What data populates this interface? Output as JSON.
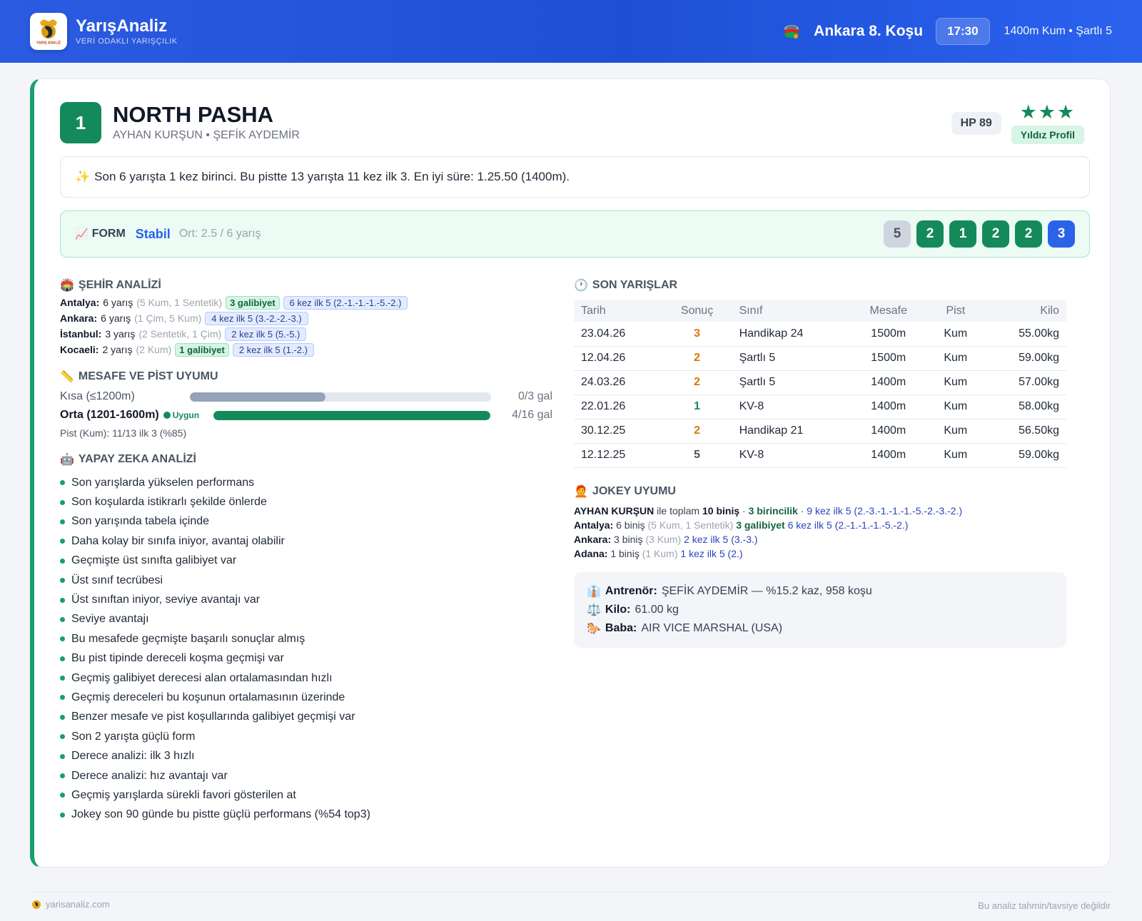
{
  "brand": {
    "name": "YarışAnaliz",
    "tagline": "VERİ ODAKLI YARIŞÇILIK",
    "logo_text": "YARIŞ ANALİZ"
  },
  "race": {
    "title": "Ankara 8. Koşu",
    "time": "17:30",
    "info": "1400m Kum • Şartlı 5",
    "icon": "saddle-icon"
  },
  "horse": {
    "number": "1",
    "name": "NORTH PASHA",
    "sub": "AYHAN KURŞUN • ŞEFİK AYDEMİR",
    "hp": "HP 89",
    "stars": "★★★",
    "profile": "Yıldız Profil"
  },
  "summary": {
    "icon": "✨",
    "text": "Son 6 yarışta 1 kez birinci. Bu pistte 13 yarışta 11 kez ilk 3. En iyi süre: 1.25.50 (1400m)."
  },
  "form": {
    "icon": "📈",
    "label": "FORM",
    "status": "Stabil",
    "avg": "Ort: 2.5 / 6 yarış",
    "results": [
      {
        "value": "5",
        "color": "gray"
      },
      {
        "value": "2",
        "color": "green"
      },
      {
        "value": "1",
        "color": "green"
      },
      {
        "value": "2",
        "color": "green"
      },
      {
        "value": "2",
        "color": "green"
      },
      {
        "value": "3",
        "color": "blue"
      }
    ]
  },
  "city_analysis": {
    "icon": "🏟️",
    "title": "ŞEHİR ANALİZİ",
    "rows": [
      {
        "city": "Antalya:",
        "races": "6 yarış",
        "detail": "(5 Kum, 1 Sentetik)",
        "wins": "3 galibiyet",
        "top5": "6 kez ilk 5 (2.-1.-1.-1.-5.-2.)"
      },
      {
        "city": "Ankara:",
        "races": "6 yarış",
        "detail": "(1 Çim, 5 Kum)",
        "wins": "",
        "top5": "4 kez ilk 5 (3.-2.-2.-3.)"
      },
      {
        "city": "İstanbul:",
        "races": "3 yarış",
        "detail": "(2 Sentetik, 1 Çim)",
        "wins": "",
        "top5": "2 kez ilk 5 (5.-5.)"
      },
      {
        "city": "Kocaeli:",
        "races": "2 yarış",
        "detail": "(2 Kum)",
        "wins": "1 galibiyet",
        "top5": "2 kez ilk 5 (1.-2.)"
      }
    ]
  },
  "distance": {
    "icon": "📏",
    "title": "MESAFE VE PİST UYUMU",
    "bars": [
      {
        "label": "Kısa (≤1200m)",
        "fit_label": "",
        "fill": 0.45,
        "value": "0/3 gal",
        "color": "#94a3b8"
      },
      {
        "label": "Orta (1201-1600m)",
        "fit_label": "Uygun",
        "fill": 1.0,
        "value": "4/16 gal",
        "color": "#148a5b"
      }
    ],
    "pist_note": "Pist (Kum): 11/13 ilk 3 (%85)"
  },
  "ai": {
    "icon": "🤖",
    "title": "YAPAY ZEKA ANALİZİ",
    "items": [
      "Son yarışlarda yükselen performans",
      "Son koşularda istikrarlı şekilde önlerde",
      "Son yarışında tabela içinde",
      "Daha kolay bir sınıfa iniyor, avantaj olabilir",
      "Geçmişte üst sınıfta galibiyet var",
      "Üst sınıf tecrübesi",
      "Üst sınıftan iniyor, seviye avantajı var",
      "Seviye avantajı",
      "Bu mesafede geçmişte başarılı sonuçlar almış",
      "Bu pist tipinde dereceli koşma geçmişi var",
      "Geçmiş galibiyet derecesi alan ortalamasından hızlı",
      "Geçmiş dereceleri bu koşunun ortalamasının üzerinde",
      "Benzer mesafe ve pist koşullarında galibiyet geçmişi var",
      "Son 2 yarışta güçlü form",
      "Derece analizi: ilk 3 hızlı",
      "Derece analizi: hız avantajı var",
      "Geçmiş yarışlarda sürekli favori gösterilen at",
      "Jokey son 90 günde bu pistte güçlü performans (%54 top3)"
    ]
  },
  "recent": {
    "icon": "🕐",
    "title": "SON YARIŞLAR",
    "headers": [
      "Tarih",
      "Sonuç",
      "Sınıf",
      "Mesafe",
      "Pist",
      "Kilo"
    ],
    "rows": [
      {
        "date": "23.04.26",
        "result": "3",
        "result_color": "orange",
        "class": "Handikap 24",
        "distance": "1500m",
        "track": "Kum",
        "weight": "55.00kg"
      },
      {
        "date": "12.04.26",
        "result": "2",
        "result_color": "orange",
        "class": "Şartlı 5",
        "distance": "1500m",
        "track": "Kum",
        "weight": "59.00kg"
      },
      {
        "date": "24.03.26",
        "result": "2",
        "result_color": "orange",
        "class": "Şartlı 5",
        "distance": "1400m",
        "track": "Kum",
        "weight": "57.00kg"
      },
      {
        "date": "22.01.26",
        "result": "1",
        "result_color": "green",
        "class": "KV-8",
        "distance": "1400m",
        "track": "Kum",
        "weight": "58.00kg"
      },
      {
        "date": "30.12.25",
        "result": "2",
        "result_color": "orange",
        "class": "Handikap 21",
        "distance": "1400m",
        "track": "Kum",
        "weight": "56.50kg"
      },
      {
        "date": "12.12.25",
        "result": "5",
        "result_color": "slate",
        "class": "KV-8",
        "distance": "1400m",
        "track": "Kum",
        "weight": "59.00kg"
      }
    ]
  },
  "jockey": {
    "icon": "🧑‍🦰",
    "title": "JOKEY UYUMU",
    "summary": {
      "name": "AYHAN KURŞUN",
      "mid": "ile toplam",
      "rides": "10 biniş",
      "wins": "3 birincilik",
      "top5": "9 kez ilk 5 (2.-3.-1.-1.-1.-5.-2.-3.-2.)"
    },
    "cities": [
      {
        "city": "Antalya:",
        "rides": "6 biniş",
        "detail": "(5 Kum, 1 Sentetik)",
        "wins": "3 galibiyet",
        "top5": "6 kez ilk 5 (2.-1.-1.-1.-5.-2.)"
      },
      {
        "city": "Ankara:",
        "rides": "3 biniş",
        "detail": "(3 Kum)",
        "wins": "",
        "top5": "2 kez ilk 5 (3.-3.)"
      },
      {
        "city": "Adana:",
        "rides": "1 biniş",
        "detail": "(1 Kum)",
        "wins": "",
        "top5": "1 kez ilk 5 (2.)"
      }
    ]
  },
  "info": {
    "trainer_icon": "👔",
    "trainer_label": "Antrenör:",
    "trainer_value": "ŞEFİK AYDEMİR — %15.2 kaz, 958 koşu",
    "weight_icon": "⚖️",
    "weight_label": "Kilo:",
    "weight_value": "61.00 kg",
    "sire_icon": "🐎",
    "sire_label": "Baba:",
    "sire_value": "AIR VICE MARSHAL (USA)"
  },
  "footer": {
    "site": "yarisanaliz.com",
    "disclaimer": "Bu analiz tahmin/tavsiye değildir"
  }
}
